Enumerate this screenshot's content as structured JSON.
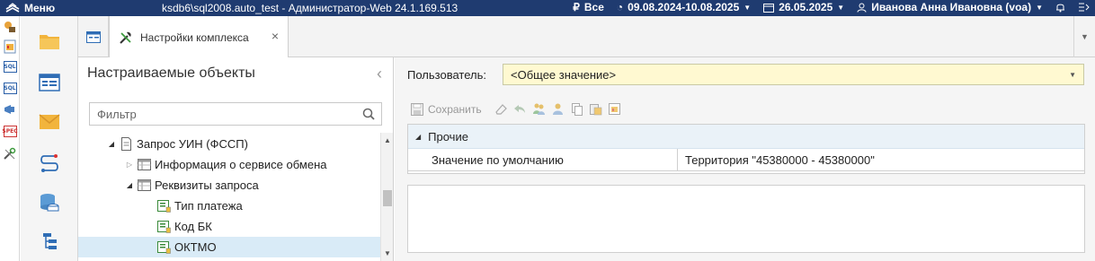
{
  "topbar": {
    "menu_label": "Меню",
    "title": "ksdb6\\sql2008.auto_test - Администратор-Web 24.1.169.513",
    "currency_label": "Все",
    "period_label": "09.08.2024-10.08.2025",
    "date_label": "26.05.2025",
    "user_label": "Иванова Анна Ивановна (voa)",
    "bg_color": "#1f3b70"
  },
  "left_tools": {
    "icons": [
      "key-lock-icon",
      "report-icon",
      "sql-icon",
      "sql-icon",
      "announce-icon",
      "spec-icon",
      "tools-icon"
    ],
    "sql_label": "SQL",
    "spec_label": "SPEC"
  },
  "nav_icons": [
    "folder-icon",
    "window-icon",
    "mail-icon",
    "route-icon",
    "database-icon",
    "tree-icon"
  ],
  "tabs": {
    "active_label": "Настройки комплекса",
    "close_glyph": "×"
  },
  "left_panel": {
    "title": "Настраиваемые объекты",
    "collapse_glyph": "‹",
    "filter_placeholder": "Фильтр",
    "tree": [
      {
        "label": "Запрос УИН (ФССП)",
        "level": 0,
        "expanded": true,
        "icon": "document-icon"
      },
      {
        "label": "Информация о сервисе обмена",
        "level": 1,
        "expanded": false,
        "icon": "table-icon"
      },
      {
        "label": "Реквизиты запроса",
        "level": 1,
        "expanded": true,
        "icon": "table-icon"
      },
      {
        "label": "Тип платежа",
        "level": 2,
        "icon": "field-icon"
      },
      {
        "label": "Код БК",
        "level": 2,
        "icon": "field-icon"
      },
      {
        "label": "ОКТМО",
        "level": 2,
        "icon": "field-icon",
        "selected": true
      }
    ]
  },
  "right_panel": {
    "user_label": "Пользователь:",
    "user_value": "<Общее значение>",
    "save_label": "Сохранить",
    "group_label": "Прочие",
    "row_name": "Значение по умолчанию",
    "row_value": "Территория \"45380000 - 45380000\"",
    "select_bg": "#fff9d1",
    "selected_bg": "#d9ebf7"
  }
}
